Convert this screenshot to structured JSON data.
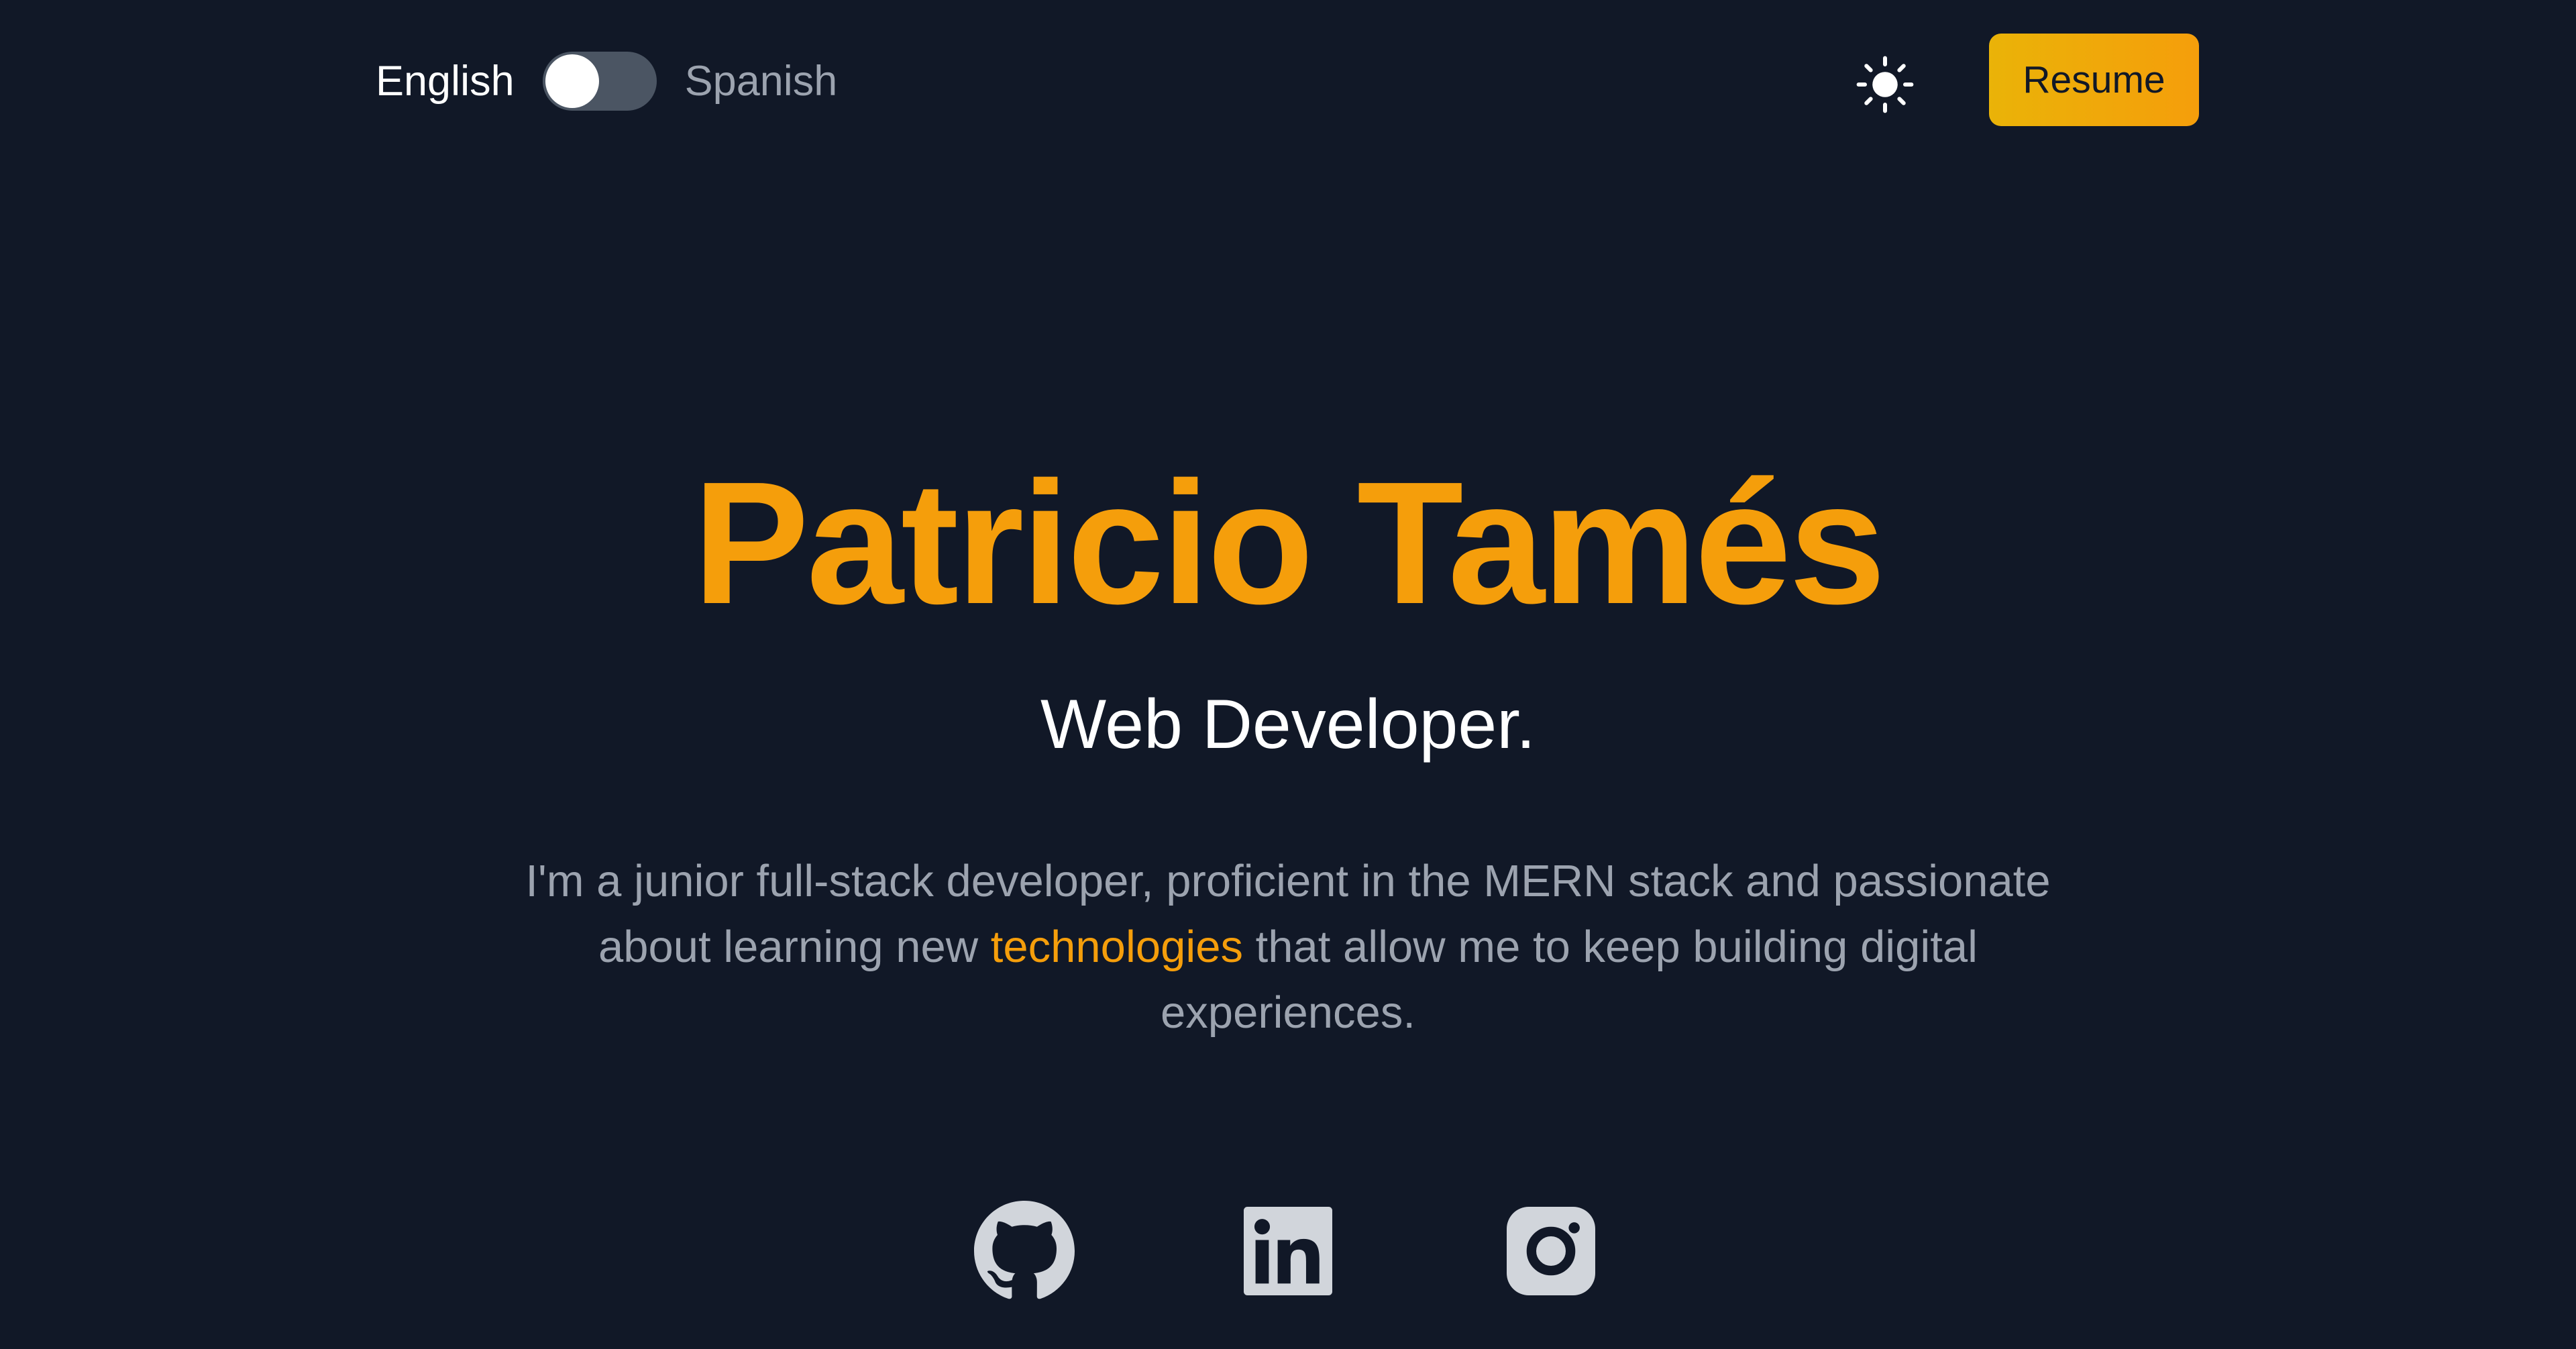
{
  "language_switch": {
    "english_label": "English",
    "spanish_label": "Spanish",
    "selected": "English"
  },
  "header": {
    "theme_icon": "sun-icon",
    "resume_label": "Resume"
  },
  "hero": {
    "name": "Patricio Tamés",
    "role": "Web Developer.",
    "description_before": "I'm a junior full-stack developer, proficient in the MERN stack and passionate about learning new ",
    "description_highlight": "technologies",
    "description_after": " that allow me to keep building digital experiences."
  },
  "social": {
    "icons": [
      "github-icon",
      "linkedin-icon",
      "instagram-icon"
    ]
  },
  "colors": {
    "background": "#111827",
    "accent": "#f59e0b",
    "text": "#ffffff",
    "muted": "#9ca3af",
    "icon": "#d1d5db"
  }
}
